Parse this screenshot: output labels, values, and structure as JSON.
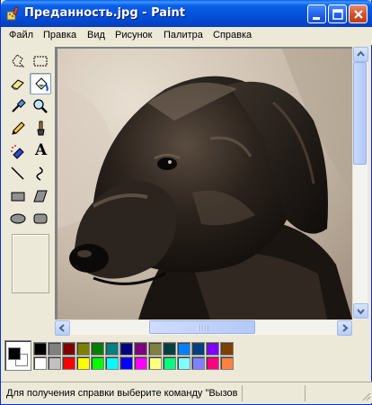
{
  "window": {
    "title": "Преданность.jpg - Paint"
  },
  "menu": [
    {
      "label": "Файл"
    },
    {
      "label": "Правка"
    },
    {
      "label": "Вид"
    },
    {
      "label": "Рисунок"
    },
    {
      "label": "Палитра"
    },
    {
      "label": "Справка"
    }
  ],
  "tools": [
    {
      "name": "free-select-icon"
    },
    {
      "name": "rect-select-icon"
    },
    {
      "name": "eraser-icon"
    },
    {
      "name": "fill-icon",
      "active": true
    },
    {
      "name": "color-picker-icon"
    },
    {
      "name": "magnifier-icon"
    },
    {
      "name": "pencil-icon"
    },
    {
      "name": "brush-icon"
    },
    {
      "name": "airbrush-icon"
    },
    {
      "name": "text-icon"
    },
    {
      "name": "line-icon"
    },
    {
      "name": "curve-icon"
    },
    {
      "name": "rectangle-icon"
    },
    {
      "name": "polygon-icon"
    },
    {
      "name": "ellipse-icon"
    },
    {
      "name": "rounded-rect-icon"
    }
  ],
  "text_tool_glyph": "A",
  "colors": {
    "foreground": "#000000",
    "background": "#ffffff",
    "palette_top": [
      "#000000",
      "#808080",
      "#800000",
      "#808000",
      "#008000",
      "#008080",
      "#000080",
      "#800080",
      "#808040",
      "#004040",
      "#0080ff",
      "#004080",
      "#8000ff",
      "#804000"
    ],
    "palette_bottom": [
      "#ffffff",
      "#c0c0c0",
      "#ff0000",
      "#ffff00",
      "#00ff00",
      "#00ffff",
      "#0000ff",
      "#ff00ff",
      "#ffff80",
      "#00ff80",
      "#80ffff",
      "#8080ff",
      "#ff0080",
      "#ff8040"
    ]
  },
  "status": {
    "text": "Для получения справки выберите команду \"Вызов"
  }
}
